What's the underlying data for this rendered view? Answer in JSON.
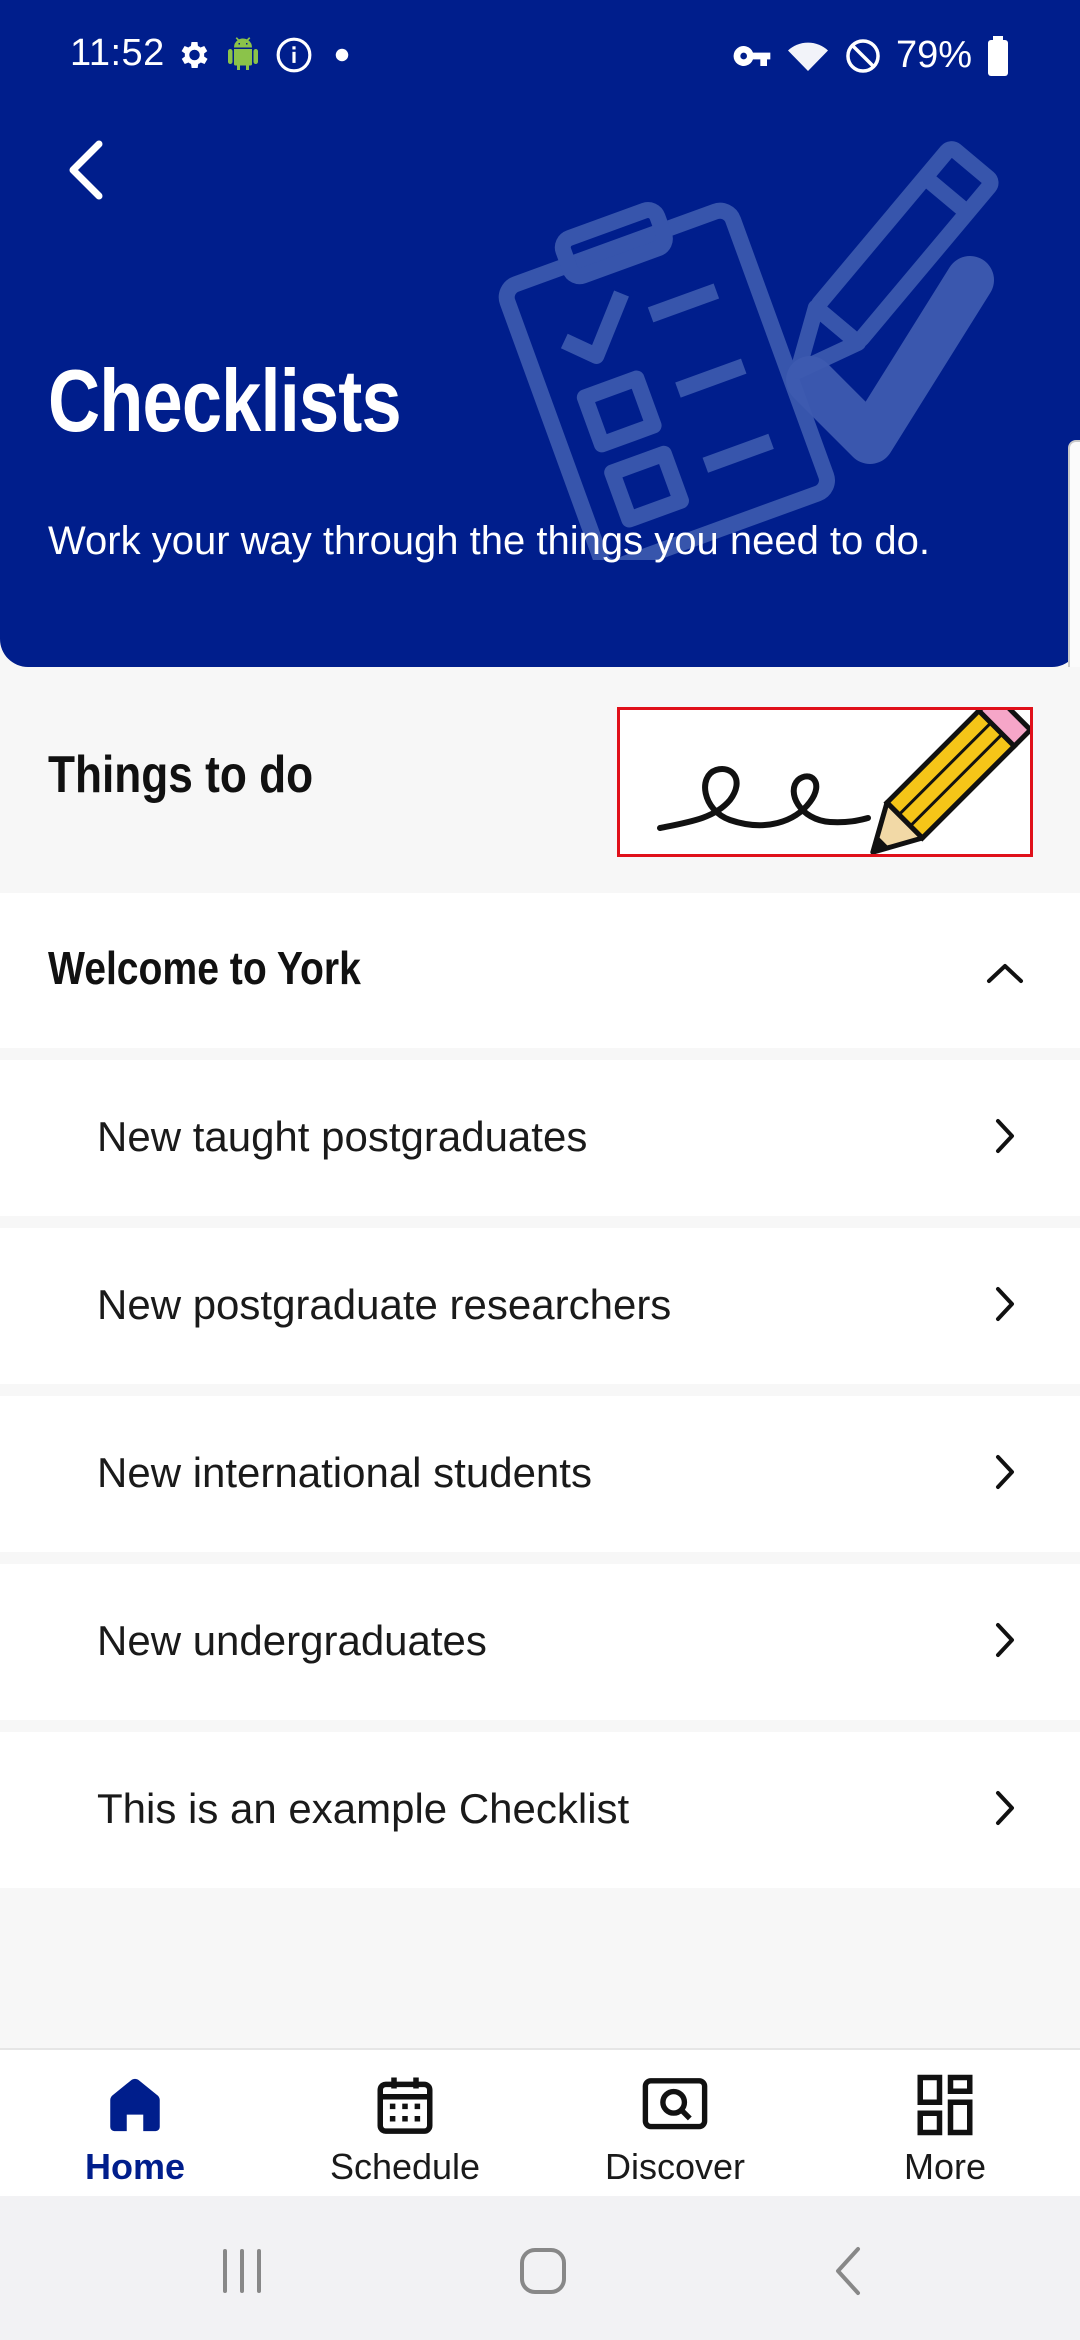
{
  "status_bar": {
    "time": "11:52",
    "battery_percent": "79%",
    "left_icons": [
      "gear-icon",
      "android-icon",
      "info-icon",
      "dot-icon"
    ],
    "right_icons": [
      "vpn-key-icon",
      "wifi-icon",
      "do-not-disturb-icon",
      "battery-icon"
    ]
  },
  "header": {
    "title": "Checklists",
    "subtitle": "Work your way through the things you need to do.",
    "background_color": "#001e8c"
  },
  "section": {
    "title": "Things to do"
  },
  "accordion": {
    "title": "Welcome to York",
    "expanded": true,
    "items": [
      {
        "label": "New taught postgraduates"
      },
      {
        "label": "New postgraduate researchers"
      },
      {
        "label": "New international students"
      },
      {
        "label": "New undergraduates"
      },
      {
        "label": "This is an example Checklist"
      }
    ]
  },
  "bottom_nav": {
    "items": [
      {
        "label": "Home",
        "icon": "home-icon",
        "active": true
      },
      {
        "label": "Schedule",
        "icon": "calendar-icon",
        "active": false
      },
      {
        "label": "Discover",
        "icon": "discover-icon",
        "active": false
      },
      {
        "label": "More",
        "icon": "grid-icon",
        "active": false
      }
    ]
  },
  "colors": {
    "brand": "#001e8c",
    "highlight_box": "#e0101a",
    "pencil": "#f5c518"
  }
}
